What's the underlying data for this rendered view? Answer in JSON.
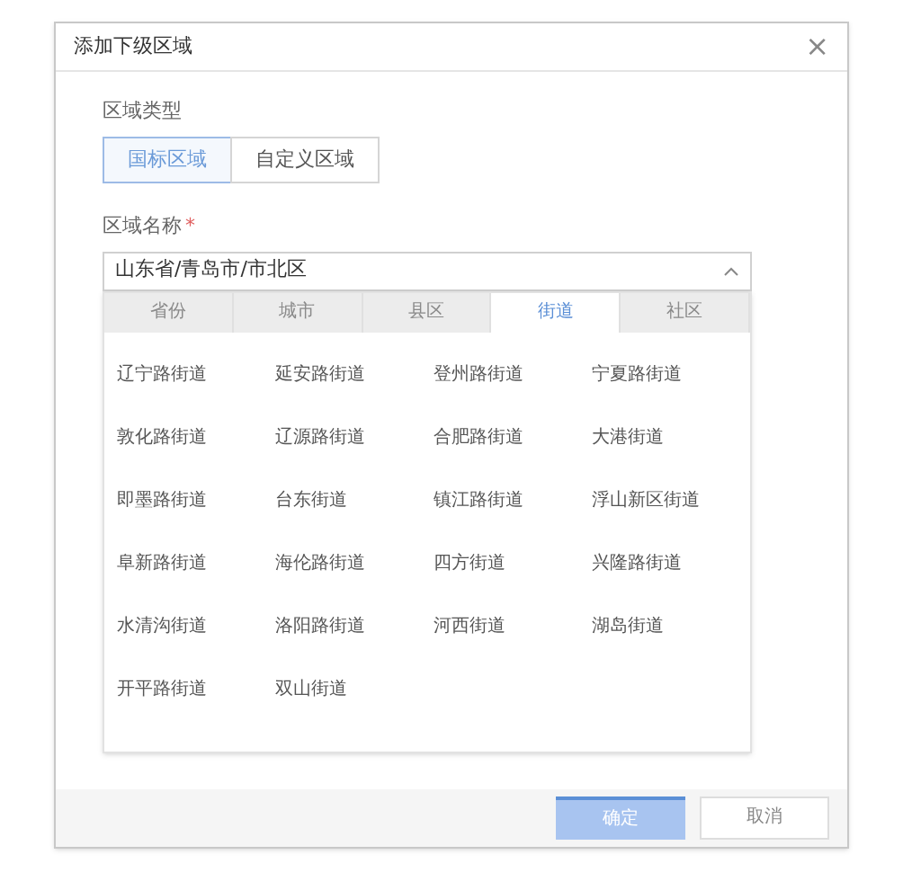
{
  "dialog": {
    "title": "添加下级区域",
    "close": "×"
  },
  "area_type": {
    "label": "区域类型",
    "options": [
      {
        "label": "国标区域",
        "selected": true
      },
      {
        "label": "自定义区域",
        "selected": false
      }
    ]
  },
  "area_name": {
    "label": "区域名称",
    "required_mark": "*",
    "value": "山东省/青岛市/市北区",
    "expanded": true
  },
  "level_tabs": [
    {
      "label": "省份",
      "selected": false
    },
    {
      "label": "城市",
      "selected": false
    },
    {
      "label": "县区",
      "selected": false
    },
    {
      "label": "街道",
      "selected": true
    },
    {
      "label": "社区",
      "selected": false
    }
  ],
  "streets": [
    "辽宁路街道",
    "延安路街道",
    "登州路街道",
    "宁夏路街道",
    "敦化路街道",
    "辽源路街道",
    "合肥路街道",
    "大港街道",
    "即墨路街道",
    "台东街道",
    "镇江路街道",
    "浮山新区街道",
    "阜新路街道",
    "海伦路街道",
    "四方街道",
    "兴隆路街道",
    "水清沟街道",
    "洛阳路街道",
    "河西街道",
    "湖岛街道",
    "开平路街道",
    "双山街道"
  ],
  "buttons": [
    {
      "label": "确定",
      "kind": "primary"
    },
    {
      "label": "取消",
      "kind": "secondary"
    }
  ]
}
